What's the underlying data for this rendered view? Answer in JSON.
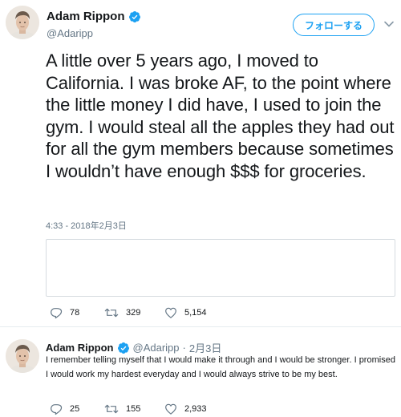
{
  "main_tweet": {
    "author_name": "Adam Rippon",
    "handle": "@Adaripp",
    "follow_label": "フォローする",
    "text": "A little over 5 years ago, I moved to California. I was broke AF, to the point where the little money I did have, I used to join the gym. I would steal all the apples they had out for all the gym members because sometimes I wouldn’t have enough $$$ for groceries.",
    "timestamp": "4:33 - 2018年2月3日",
    "reply_count": "78",
    "retweet_count": "329",
    "like_count": "5,154"
  },
  "reply_tweet": {
    "author_name": "Adam Rippon",
    "handle": "@Adaripp",
    "separator": "·",
    "date": "2月3日",
    "text": "I remember telling myself that I would make it through and I would be stronger. I promised I would work my hardest everyday and I would always strive to be my best.",
    "reply_count": "25",
    "retweet_count": "155",
    "like_count": "2,933"
  },
  "colors": {
    "accent": "#1da1f2",
    "text": "#14171a",
    "secondary_text": "#657786",
    "border": "#d6dbe0"
  },
  "icons": [
    "verified-badge-icon",
    "chevron-down-icon",
    "reply-icon",
    "retweet-icon",
    "like-icon"
  ]
}
